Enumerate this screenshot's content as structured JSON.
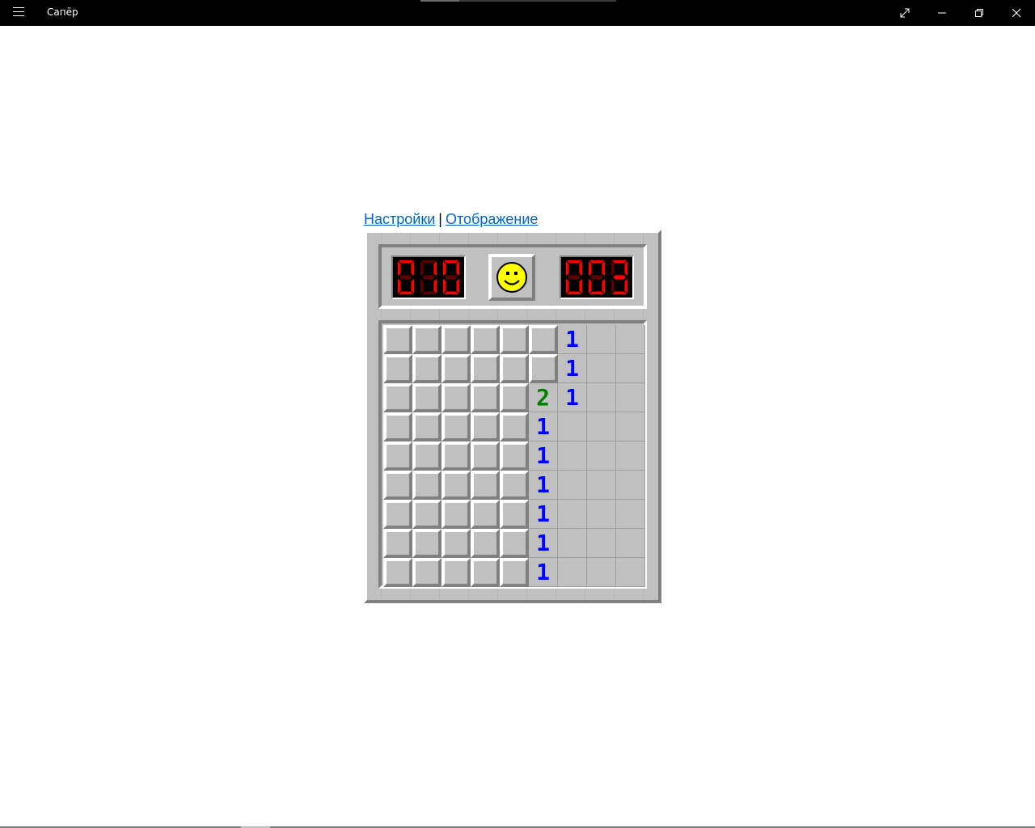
{
  "window": {
    "title": "Сапёр",
    "menu_icon": "hamburger-icon",
    "controls": [
      "fullscreen-icon",
      "minimize-icon",
      "restore-icon",
      "close-icon"
    ]
  },
  "links": {
    "settings": "Настройки",
    "separator": "|",
    "display": "Отображение"
  },
  "game": {
    "mine_counter": "010",
    "timer": "003",
    "timer_display_glyphs": [
      "0",
      "0",
      "3"
    ],
    "face": "smiley-face-icon",
    "rows": 9,
    "cols": 9,
    "board": [
      [
        "H",
        "H",
        "H",
        "H",
        "H",
        "H",
        "1",
        "0",
        "0"
      ],
      [
        "H",
        "H",
        "H",
        "H",
        "H",
        "H",
        "1",
        "0",
        "0"
      ],
      [
        "H",
        "H",
        "H",
        "H",
        "H",
        "2",
        "1",
        "0",
        "0"
      ],
      [
        "H",
        "H",
        "H",
        "H",
        "H",
        "1",
        "0",
        "0",
        "0"
      ],
      [
        "H",
        "H",
        "H",
        "H",
        "H",
        "1",
        "0",
        "0",
        "0"
      ],
      [
        "H",
        "H",
        "H",
        "H",
        "H",
        "1",
        "0",
        "0",
        "0"
      ],
      [
        "H",
        "H",
        "H",
        "H",
        "H",
        "1",
        "0",
        "0",
        "0"
      ],
      [
        "H",
        "H",
        "H",
        "H",
        "H",
        "1",
        "0",
        "0",
        "0"
      ],
      [
        "H",
        "H",
        "H",
        "H",
        "H",
        "1",
        "0",
        "0",
        "0"
      ]
    ],
    "colors": {
      "number_1": "#0000ff",
      "number_2": "#008000",
      "led_on": "#ff0000",
      "led_off": "#5a0000",
      "face": "#ffff00"
    }
  }
}
